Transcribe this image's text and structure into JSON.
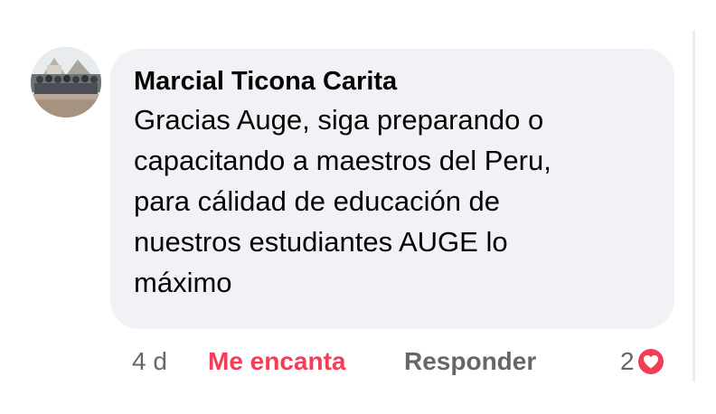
{
  "comment": {
    "author": "Marcial Ticona Carita",
    "text_lines": [
      "Gracias Auge, siga preparando  o",
      "capacitando a maestros del Peru,",
      "para cálidad de educación de",
      "nuestros estudiantes AUGE lo",
      "máximo"
    ],
    "avatar_icon": "profile-photo"
  },
  "actions": {
    "time": "4 d",
    "reaction_label": "Me encanta",
    "reply_label": "Responder",
    "reaction_count": "2",
    "reaction_icon": "love-heart-icon"
  },
  "colors": {
    "bubble": "#f0f2f5",
    "reaction_red": "#f33e58",
    "secondary_text": "#65676b",
    "primary_text": "#050505"
  }
}
